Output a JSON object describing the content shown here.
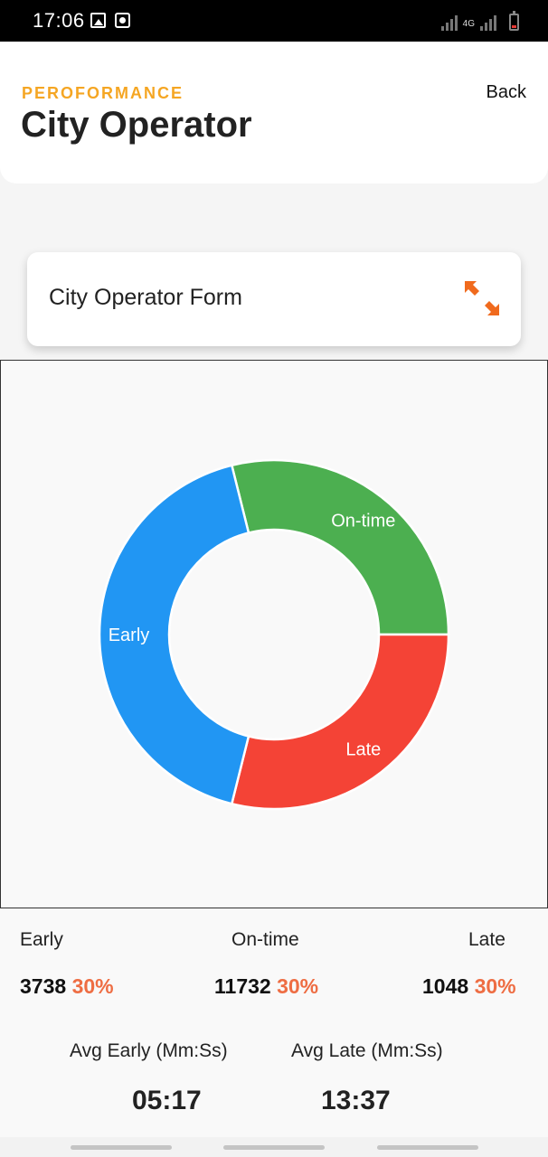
{
  "status_bar": {
    "time": "17:06",
    "left_icons": [
      "photo-icon",
      "record-icon"
    ],
    "network": "4G",
    "battery_color": "#e53935"
  },
  "header": {
    "subtitle": "PEROFORMANCE",
    "title": "City Operator",
    "back_label": "Back",
    "accent_color": "#f5a623"
  },
  "form_card": {
    "title": "City Operator Form",
    "icon": "expand-arrows-icon",
    "icon_color": "#f06a1d"
  },
  "chart_data": {
    "type": "pie",
    "style": "donut",
    "slices": [
      {
        "label": "On-time",
        "value": 11732,
        "color": "#4caf50"
      },
      {
        "label": "Late",
        "value": 1048,
        "color": "#f44336"
      },
      {
        "label": "Early",
        "value": 3738,
        "color": "#2196f3"
      }
    ]
  },
  "stats": {
    "early": {
      "label": "Early",
      "count": "3738",
      "percent": "30%"
    },
    "ontime": {
      "label": "On-time",
      "count": "11732",
      "percent": "30%"
    },
    "late": {
      "label": "Late",
      "count": "1048",
      "percent": "30%"
    },
    "avg_early": {
      "label": "Avg Early (Mm:Ss)",
      "value": "05:17"
    },
    "avg_late": {
      "label": "Avg Late (Mm:Ss)",
      "value": "13:37"
    },
    "percent_color": "#ee6d43"
  }
}
